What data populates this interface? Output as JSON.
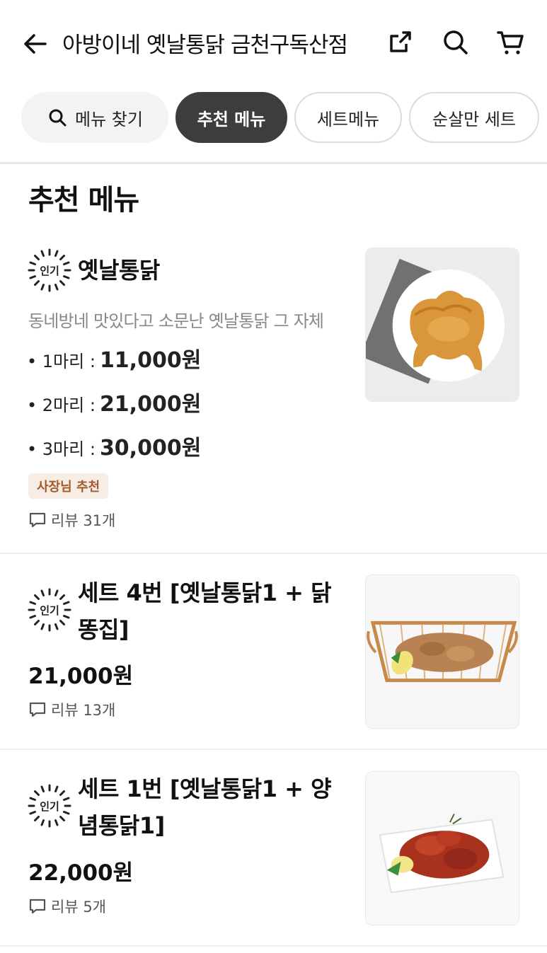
{
  "header": {
    "store_name": "아방이네 옛날통닭 금천구독산점",
    "icons": [
      "back-arrow-icon",
      "share-icon",
      "search-icon",
      "cart-icon"
    ]
  },
  "tabs": {
    "search_label": "메뉴 찾기",
    "items": [
      "추천 메뉴",
      "세트메뉴",
      "순살만 세트"
    ],
    "active": "추천 메뉴"
  },
  "section": {
    "title": "추천 메뉴"
  },
  "menu": [
    {
      "badge": "인기",
      "name": "옛날통닭",
      "description": "동네방네 맛있다고 소문난 옛날통닭 그 자체",
      "prices": [
        {
          "label": "• 1마리 :",
          "value": "11,000원"
        },
        {
          "label": "• 2마리 :",
          "value": "21,000원"
        },
        {
          "label": "• 3마리 :",
          "value": "30,000원"
        }
      ],
      "tag": "사장님 추천",
      "review": "리뷰 31개"
    },
    {
      "badge": "인기",
      "name": "세트 4번 [옛날통닭1 + 닭똥집]",
      "price": "21,000원",
      "review": "리뷰 13개"
    },
    {
      "badge": "인기",
      "name": "세트 1번 [옛날통닭1 + 양념통닭1]",
      "price": "22,000원",
      "review": "리뷰 5개"
    }
  ],
  "colors": {
    "active_tab": "#3d3d3d",
    "owner_tag_bg": "#f7ede4",
    "owner_tag_text": "#a05a2c"
  }
}
